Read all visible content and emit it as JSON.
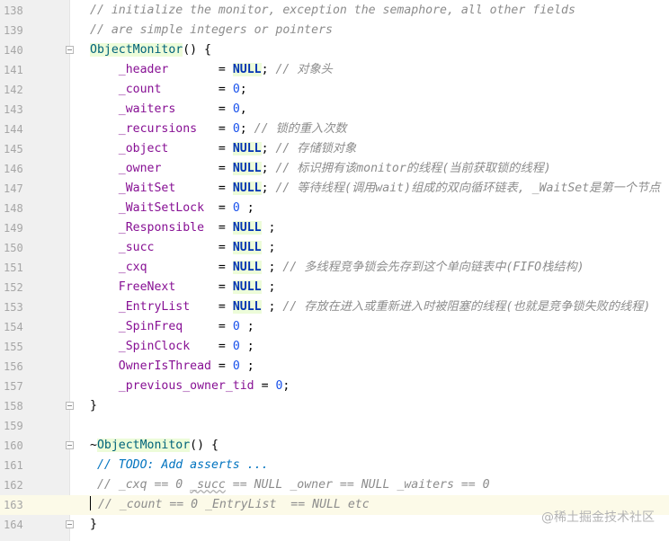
{
  "lines": [
    {
      "num": "138",
      "segs": [
        {
          "t": "// initialize the monitor, exception the semaphore, all other fields",
          "c": "c"
        }
      ]
    },
    {
      "num": "139",
      "segs": [
        {
          "t": "// are simple integers or pointers",
          "c": "c"
        }
      ]
    },
    {
      "num": "140",
      "fold": true,
      "segs": [
        {
          "t": "ObjectMonitor",
          "c": "fn"
        },
        {
          "t": "() {",
          "c": ""
        }
      ]
    },
    {
      "num": "141",
      "segs": [
        {
          "t": "    ",
          "c": ""
        },
        {
          "t": "_header",
          "c": "f"
        },
        {
          "t": "       = ",
          "c": ""
        },
        {
          "t": "NULL",
          "c": "kw"
        },
        {
          "t": "; ",
          "c": ""
        },
        {
          "t": "// 对象头",
          "c": "c"
        }
      ]
    },
    {
      "num": "142",
      "segs": [
        {
          "t": "    ",
          "c": ""
        },
        {
          "t": "_count",
          "c": "f"
        },
        {
          "t": "        = ",
          "c": ""
        },
        {
          "t": "0",
          "c": "n"
        },
        {
          "t": ";",
          "c": ""
        }
      ]
    },
    {
      "num": "143",
      "segs": [
        {
          "t": "    ",
          "c": ""
        },
        {
          "t": "_waiters",
          "c": "f"
        },
        {
          "t": "      = ",
          "c": ""
        },
        {
          "t": "0",
          "c": "n"
        },
        {
          "t": ",",
          "c": ""
        }
      ]
    },
    {
      "num": "144",
      "segs": [
        {
          "t": "    ",
          "c": ""
        },
        {
          "t": "_recursions",
          "c": "f"
        },
        {
          "t": "   = ",
          "c": ""
        },
        {
          "t": "0",
          "c": "n"
        },
        {
          "t": "; ",
          "c": ""
        },
        {
          "t": "// 锁的重入次数",
          "c": "c"
        }
      ]
    },
    {
      "num": "145",
      "segs": [
        {
          "t": "    ",
          "c": ""
        },
        {
          "t": "_object",
          "c": "f"
        },
        {
          "t": "       = ",
          "c": ""
        },
        {
          "t": "NULL",
          "c": "kw"
        },
        {
          "t": "; ",
          "c": ""
        },
        {
          "t": "// 存储锁对象",
          "c": "c"
        }
      ]
    },
    {
      "num": "146",
      "segs": [
        {
          "t": "    ",
          "c": ""
        },
        {
          "t": "_owner",
          "c": "f"
        },
        {
          "t": "        = ",
          "c": ""
        },
        {
          "t": "NULL",
          "c": "kw"
        },
        {
          "t": "; ",
          "c": ""
        },
        {
          "t": "// 标识拥有该monitor的线程(当前获取锁的线程)",
          "c": "c"
        }
      ]
    },
    {
      "num": "147",
      "segs": [
        {
          "t": "    ",
          "c": ""
        },
        {
          "t": "_WaitSet",
          "c": "f"
        },
        {
          "t": "      = ",
          "c": ""
        },
        {
          "t": "NULL",
          "c": "kw"
        },
        {
          "t": "; ",
          "c": ""
        },
        {
          "t": "// 等待线程(调用wait)组成的双向循环链表, _WaitSet是第一个节点",
          "c": "c"
        }
      ]
    },
    {
      "num": "148",
      "segs": [
        {
          "t": "    ",
          "c": ""
        },
        {
          "t": "_WaitSetLock",
          "c": "f"
        },
        {
          "t": "  = ",
          "c": ""
        },
        {
          "t": "0",
          "c": "n"
        },
        {
          "t": " ;",
          "c": ""
        }
      ]
    },
    {
      "num": "149",
      "segs": [
        {
          "t": "    ",
          "c": ""
        },
        {
          "t": "_Responsible",
          "c": "f"
        },
        {
          "t": "  = ",
          "c": ""
        },
        {
          "t": "NULL",
          "c": "kw"
        },
        {
          "t": " ;",
          "c": ""
        }
      ]
    },
    {
      "num": "150",
      "segs": [
        {
          "t": "    ",
          "c": ""
        },
        {
          "t": "_succ",
          "c": "f"
        },
        {
          "t": "         = ",
          "c": ""
        },
        {
          "t": "NULL",
          "c": "kw"
        },
        {
          "t": " ;",
          "c": ""
        }
      ]
    },
    {
      "num": "151",
      "segs": [
        {
          "t": "    ",
          "c": ""
        },
        {
          "t": "_cxq",
          "c": "f"
        },
        {
          "t": "          = ",
          "c": ""
        },
        {
          "t": "NULL",
          "c": "kw"
        },
        {
          "t": " ; ",
          "c": ""
        },
        {
          "t": "// 多线程竞争锁会先存到这个单向链表中(FIFO栈结构)",
          "c": "c"
        }
      ]
    },
    {
      "num": "152",
      "segs": [
        {
          "t": "    ",
          "c": ""
        },
        {
          "t": "FreeNext",
          "c": "f"
        },
        {
          "t": "      = ",
          "c": ""
        },
        {
          "t": "NULL",
          "c": "kw"
        },
        {
          "t": " ;",
          "c": ""
        }
      ]
    },
    {
      "num": "153",
      "segs": [
        {
          "t": "    ",
          "c": ""
        },
        {
          "t": "_EntryList",
          "c": "f"
        },
        {
          "t": "    = ",
          "c": ""
        },
        {
          "t": "NULL",
          "c": "kw"
        },
        {
          "t": " ; ",
          "c": ""
        },
        {
          "t": "// 存放在进入或重新进入时被阻塞的线程(也就是竞争锁失败的线程)",
          "c": "c"
        }
      ]
    },
    {
      "num": "154",
      "segs": [
        {
          "t": "    ",
          "c": ""
        },
        {
          "t": "_SpinFreq",
          "c": "f"
        },
        {
          "t": "     = ",
          "c": ""
        },
        {
          "t": "0",
          "c": "n"
        },
        {
          "t": " ;",
          "c": ""
        }
      ]
    },
    {
      "num": "155",
      "segs": [
        {
          "t": "    ",
          "c": ""
        },
        {
          "t": "_SpinClock",
          "c": "f"
        },
        {
          "t": "    = ",
          "c": ""
        },
        {
          "t": "0",
          "c": "n"
        },
        {
          "t": " ;",
          "c": ""
        }
      ]
    },
    {
      "num": "156",
      "segs": [
        {
          "t": "    ",
          "c": ""
        },
        {
          "t": "OwnerIsThread",
          "c": "f"
        },
        {
          "t": " = ",
          "c": ""
        },
        {
          "t": "0",
          "c": "n"
        },
        {
          "t": " ;",
          "c": ""
        }
      ]
    },
    {
      "num": "157",
      "segs": [
        {
          "t": "    ",
          "c": ""
        },
        {
          "t": "_previous_owner_tid",
          "c": "f"
        },
        {
          "t": " = ",
          "c": ""
        },
        {
          "t": "0",
          "c": "n"
        },
        {
          "t": ";",
          "c": ""
        }
      ]
    },
    {
      "num": "158",
      "fold": true,
      "segs": [
        {
          "t": "}",
          "c": ""
        }
      ]
    },
    {
      "num": "159",
      "segs": []
    },
    {
      "num": "160",
      "fold": true,
      "segs": [
        {
          "t": "~",
          "c": ""
        },
        {
          "t": "ObjectMonitor",
          "c": "fn"
        },
        {
          "t": "() {",
          "c": ""
        }
      ]
    },
    {
      "num": "161",
      "segs": [
        {
          "t": " ",
          "c": ""
        },
        {
          "t": "// TODO: Add asserts ...",
          "c": "todo"
        }
      ]
    },
    {
      "num": "162",
      "segs": [
        {
          "t": " // _cxq == 0 ",
          "c": "c"
        },
        {
          "t": "_succ",
          "c": "c ul"
        },
        {
          "t": " == NULL _owner == NULL _waiters == 0",
          "c": "c"
        }
      ]
    },
    {
      "num": "163",
      "current": true,
      "segs": [
        {
          "t": " // _count == 0 _EntryList  == NULL etc",
          "c": "c"
        }
      ]
    },
    {
      "num": "164",
      "fold": true,
      "segs": [
        {
          "t": "}",
          "c": ""
        }
      ]
    }
  ],
  "watermark": "@稀土掘金技术社区"
}
